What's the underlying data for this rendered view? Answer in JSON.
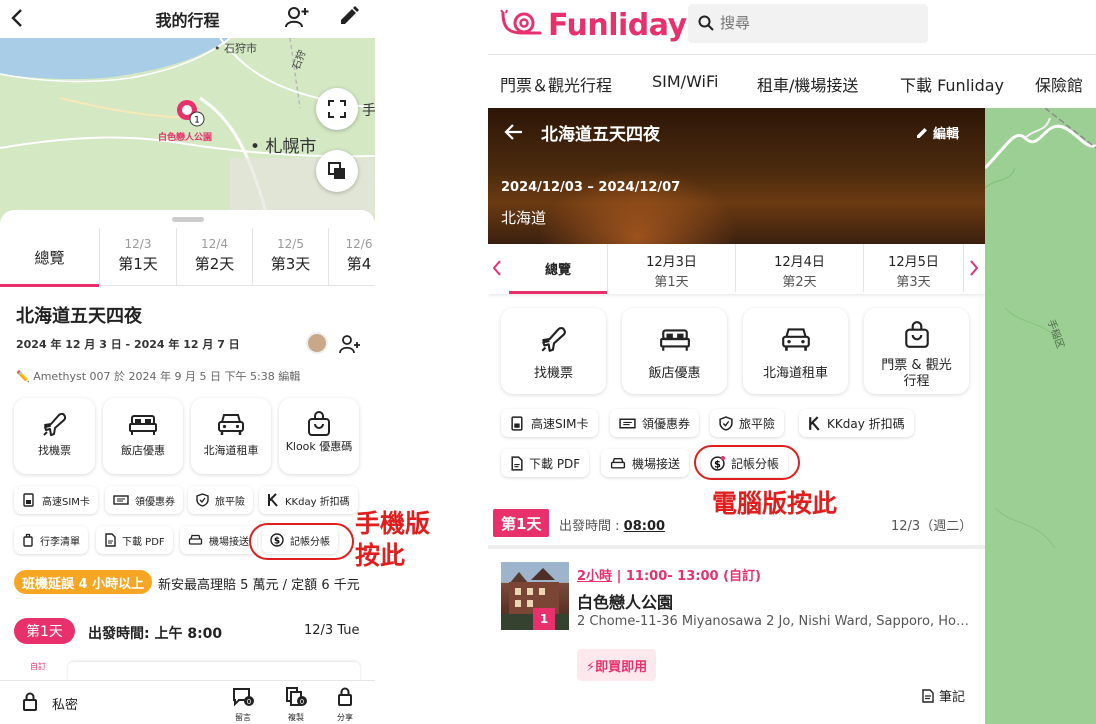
{
  "mobile": {
    "header": {
      "title": "我的行程"
    },
    "map": {
      "labels": [
        "石狩市",
        "石狩"
      ],
      "city": "札幌市",
      "pin_number": "1",
      "pin_label": "白色戀人公園",
      "edge_label": "手"
    },
    "tabs": [
      {
        "label": "總覽",
        "date": ""
      },
      {
        "label": "第1天",
        "date": "12/3"
      },
      {
        "label": "第2天",
        "date": "12/4"
      },
      {
        "label": "第3天",
        "date": "12/5"
      },
      {
        "label": "第4",
        "date": "12/6"
      }
    ],
    "trip": {
      "title": "北海道五天四夜",
      "dates": "2024 年 12 月 3 日 - 2024 年 12 月 7 日",
      "edit_note": "✏️ Amethyst 007 於 2024 年 9 月 5 日 下午 5:38 編輯"
    },
    "cards": [
      {
        "label": "找機票",
        "icon": "plane-icon"
      },
      {
        "label": "飯店優惠",
        "icon": "bed-icon"
      },
      {
        "label": "北海道租車",
        "icon": "car-icon"
      },
      {
        "label": "Klook 優惠碼",
        "icon": "shopping-bag-icon"
      }
    ],
    "chips": [
      {
        "label": "高速SIM卡",
        "icon": "sim-icon"
      },
      {
        "label": "領優惠券",
        "icon": "ticket-icon"
      },
      {
        "label": "旅平險",
        "icon": "shield-icon"
      },
      {
        "label": "KKday 折扣碼",
        "icon": "kkday-icon"
      },
      {
        "label": "行李清單",
        "icon": "luggage-icon"
      },
      {
        "label": "下載 PDF",
        "icon": "pdf-icon"
      },
      {
        "label": "機場接送",
        "icon": "car-icon"
      },
      {
        "label": "記帳分帳",
        "icon": "dollar-icon"
      }
    ],
    "promo": {
      "badge": "班機延誤 4 小時以上",
      "text": "新安最高理賠 5 萬元 / 定額 6 千元"
    },
    "day": {
      "badge": "第1天",
      "depart": "出發時間:  上午 8:00",
      "date": "12/3 Tue",
      "peek_tag": "自訂"
    },
    "bottom": {
      "private_label": "私密",
      "actions": [
        {
          "label": "留言",
          "count": "0",
          "icon": "comment-icon"
        },
        {
          "label": "複製",
          "count": "0",
          "icon": "copy-icon"
        },
        {
          "label": "分享",
          "icon": "share-icon"
        }
      ]
    },
    "annotation": "手機版\n按此"
  },
  "desktop": {
    "brand": "Funliday",
    "search": {
      "placeholder": "搜尋"
    },
    "nav": [
      "門票＆觀光行程",
      "SIM/WiFi",
      "租車/機場接送",
      "下載 Funliday",
      "保險館"
    ],
    "hero": {
      "title": "北海道五天四夜",
      "edit_label": "編輯",
      "dates": "2024/12/03  –  2024/12/07",
      "location": "北海道"
    },
    "tabs": [
      {
        "label": "總覽",
        "date": ""
      },
      {
        "label": "第1天",
        "date": "12月3日"
      },
      {
        "label": "第2天",
        "date": "12月4日"
      },
      {
        "label": "第3天",
        "date": "12月5日"
      }
    ],
    "cards": [
      {
        "label": "找機票",
        "icon": "plane-icon"
      },
      {
        "label": "飯店優惠",
        "icon": "bed-icon"
      },
      {
        "label": "北海道租車",
        "icon": "car-icon"
      },
      {
        "label": "門票 & 觀光行程",
        "icon": "shopping-bag-icon"
      }
    ],
    "chips": [
      {
        "label": "高速SIM卡",
        "icon": "sim-icon"
      },
      {
        "label": "領優惠券",
        "icon": "ticket-icon"
      },
      {
        "label": "旅平險",
        "icon": "shield-icon"
      },
      {
        "label": "KKday 折扣碼",
        "icon": "kkday-icon"
      },
      {
        "label": "下載 PDF",
        "icon": "pdf-icon"
      },
      {
        "label": "機場接送",
        "icon": "car-icon"
      },
      {
        "label": "記帳分帳",
        "icon": "dollar-icon"
      }
    ],
    "day": {
      "badge": "第1天",
      "depart_label": "出發時間 : ",
      "depart_time": "08:00",
      "date": "12/3（週二）"
    },
    "place": {
      "number": "1",
      "duration": "2小時",
      "time": "11:00- 13:00 (自訂)",
      "name": "白色戀人公園",
      "address": "2 Chome-11-36 Miyanosawa 2 Jo, Nishi Ward, Sapporo, Hokkaido",
      "buy_now": "⚡即買即用",
      "note": "筆記"
    },
    "map": {
      "label": "手稲区"
    },
    "annotation": "電腦版按此"
  },
  "colors": {
    "accent": "#e8316c",
    "annotation": "#e01e1e",
    "promo": "#f7a623"
  }
}
